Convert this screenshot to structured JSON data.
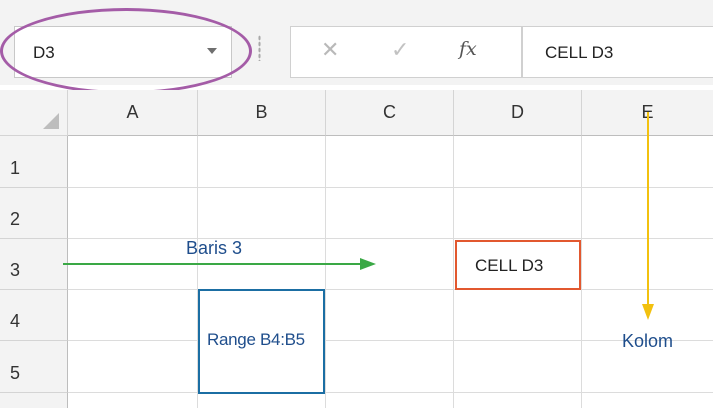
{
  "name_box": {
    "value": "D3"
  },
  "formula_buttons": {
    "cancel": "✕",
    "enter": "✓",
    "insert_function": "fx"
  },
  "formula_bar": {
    "value": "CELL D3"
  },
  "columns": [
    "A",
    "B",
    "C",
    "D",
    "E"
  ],
  "rows": [
    "1",
    "2",
    "3",
    "4",
    "5"
  ],
  "cells": {
    "D3": "CELL D3"
  },
  "annotations": {
    "row_label": "Baris 3",
    "range_label": "Range B4:B5",
    "column_label": "Kolom"
  },
  "colors": {
    "name_box_highlight": "#a45ca7",
    "row_arrow": "#3aa845",
    "column_arrow": "#f2c10f",
    "active_cell_border": "#e2582f",
    "range_border": "#1b6ea3",
    "annotation_text": "#1f4e8c"
  }
}
